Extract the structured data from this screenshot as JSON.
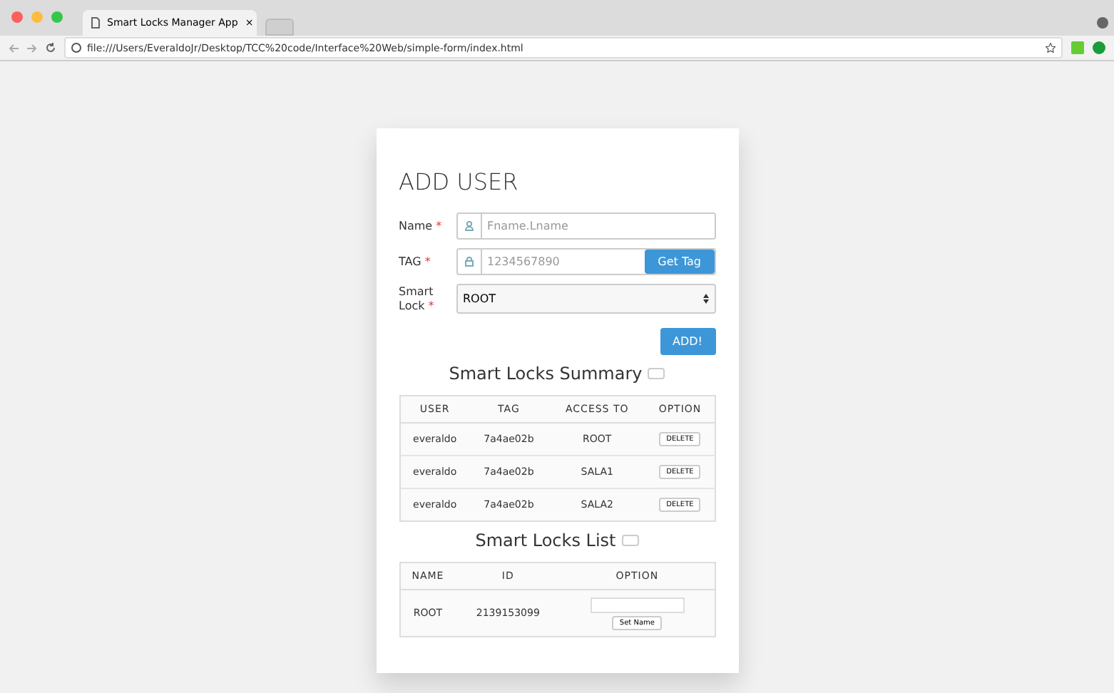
{
  "browser": {
    "tab_title": "Smart Locks Manager App",
    "tab_close": "×",
    "address": "file:///Users/EveraldoJr/Desktop/TCC%20code/Interface%20Web/simple-form/index.html"
  },
  "form": {
    "title": "ADD USER",
    "fields": [
      {
        "kind": "text",
        "label": "Name",
        "required": true,
        "placeholder": "Fname.Lname"
      },
      {
        "kind": "tag",
        "label": "TAG",
        "required": true,
        "placeholder": "1234567890",
        "button": "Get Tag"
      },
      {
        "kind": "select",
        "label": "Smart Lock",
        "required": true,
        "value": "ROOT"
      }
    ],
    "required_mark": "*",
    "submit": "ADD!"
  },
  "summary": {
    "title": "Smart Locks Summary",
    "columns": [
      "USER",
      "TAG",
      "ACCESS TO",
      "OPTION"
    ],
    "rows": [
      {
        "user": "everaldo",
        "tag": "7a4ae02b",
        "access": "ROOT",
        "action": "DELETE"
      },
      {
        "user": "everaldo",
        "tag": "7a4ae02b",
        "access": "SALA1",
        "action": "DELETE"
      },
      {
        "user": "everaldo",
        "tag": "7a4ae02b",
        "access": "SALA2",
        "action": "DELETE"
      }
    ]
  },
  "locks": {
    "title": "Smart Locks List",
    "columns": [
      "NAME",
      "ID",
      "OPTION"
    ],
    "rows": [
      {
        "name": "ROOT",
        "id": "2139153099",
        "action": "Set Name"
      }
    ]
  }
}
